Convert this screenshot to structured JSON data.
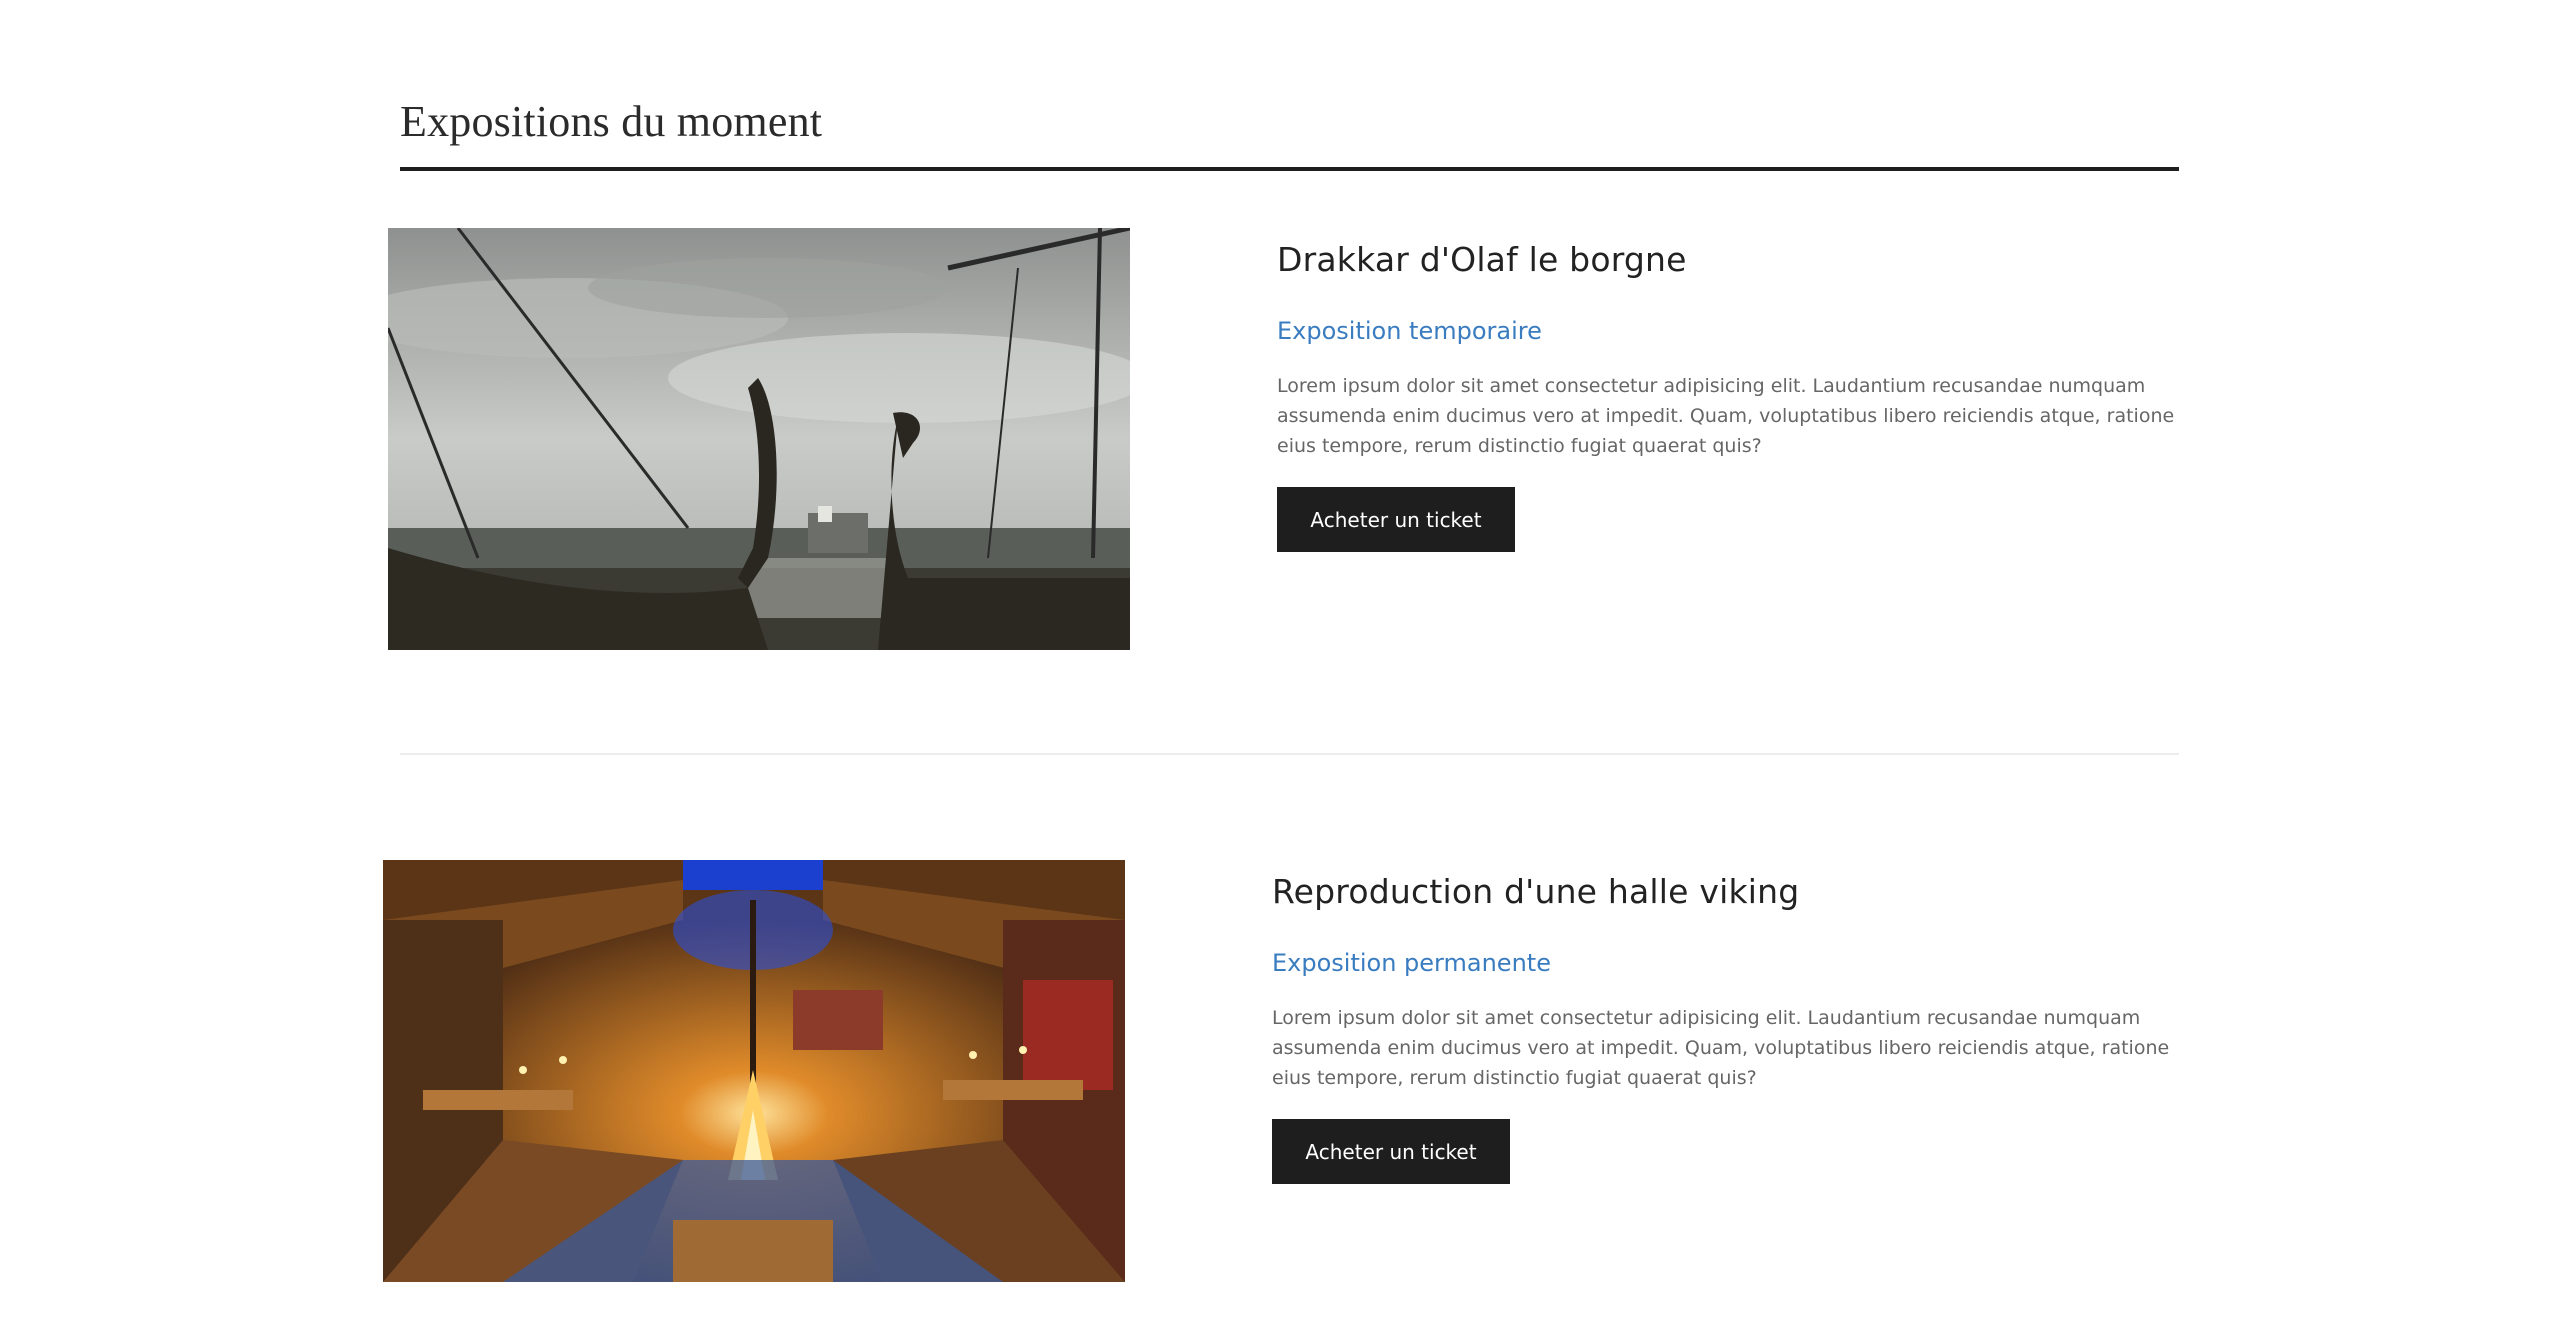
{
  "section": {
    "title": "Expositions du moment"
  },
  "exhibitions": [
    {
      "title": "Drakkar d'Olaf le borgne",
      "type": "Exposition temporaire",
      "description": "Lorem ipsum dolor sit amet consectetur adipisicing elit. Laudantium recusandae numquam assumenda enim ducimus vero at impedit. Quam, voluptatibus libero reiciendis atque, ratione eius tempore, rerum distinctio fugiat quaerat quis?",
      "button_label": "Acheter un ticket",
      "image": "viking-ships-photo"
    },
    {
      "title": "Reproduction d'une halle viking",
      "type": "Exposition permanente",
      "description": "Lorem ipsum dolor sit amet consectetur adipisicing elit. Laudantium recusandae numquam assumenda enim ducimus vero at impedit. Quam, voluptatibus libero reiciendis atque, ratione eius tempore, rerum distinctio fugiat quaerat quis?",
      "button_label": "Acheter un ticket",
      "image": "viking-hall-photo"
    }
  ],
  "colors": {
    "accent_link": "#3a7cc0",
    "button_bg": "#1e1e1e",
    "rule": "#1f1f1f"
  }
}
